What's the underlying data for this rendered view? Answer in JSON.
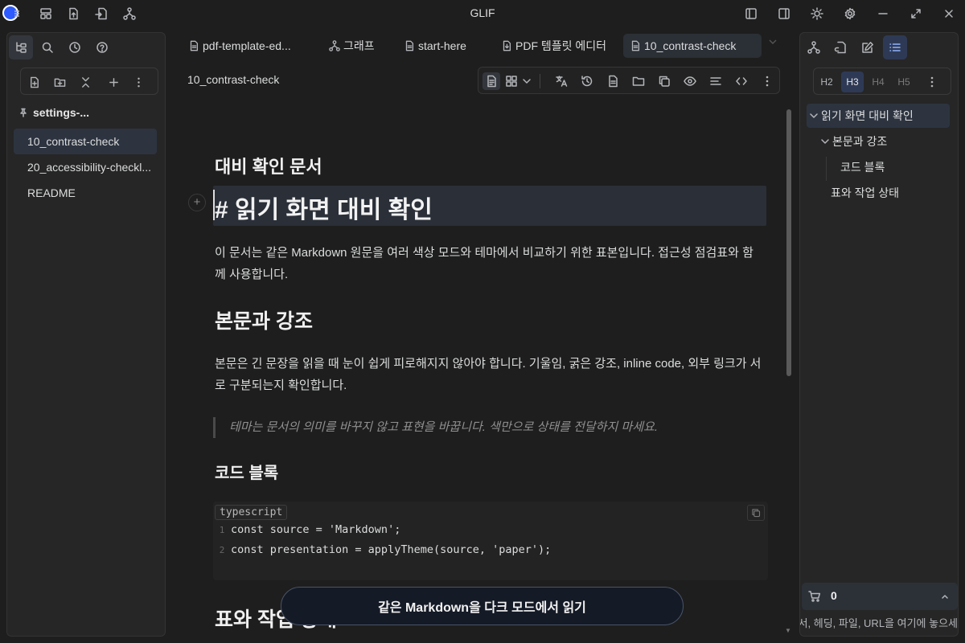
{
  "window": {
    "title": "GLIF"
  },
  "left_sidebar": {
    "vault_name": "settings-...",
    "files": [
      {
        "name": "10_contrast-check",
        "active": true
      },
      {
        "name": "20_accessibility-checkl..."
      },
      {
        "name": "README"
      }
    ]
  },
  "tabs": [
    {
      "label": "pdf-template-ed...",
      "icon": "file-icon"
    },
    {
      "label": "그래프",
      "icon": "graph-icon"
    },
    {
      "label": "start-here",
      "icon": "file-icon"
    },
    {
      "label": "PDF 템플릿 에디터",
      "icon": "pdf-icon"
    },
    {
      "label": "10_contrast-check",
      "icon": "file-icon",
      "active": true
    }
  ],
  "editor": {
    "doc_title": "10_contrast-check",
    "doc_heading": "대비 확인 문서",
    "h1": "# 읽기 화면 대비 확인",
    "para1_line1": "이 문서는 같은 Markdown 원문을 여러 색상 모드와 테마에서 비교하기 위한 표본입니다. 접근성 점검표와 함",
    "para1_line2": "께 사용합니다.",
    "h2_body": "본문과 강조",
    "para2_line1": "본문은 긴 문장을 읽을 때 눈이 쉽게 피로해지지 않아야 합니다. 기울임, 굵은 강조, inline code, 외부 링크가 서",
    "para2_line2": "로 구분되는지 확인합니다.",
    "quote": "테마는 문서의 의미를 바꾸지 않고 표현을 바꿉니다. 색만으로 상태를 전달하지 마세요.",
    "h3_code": "코드 블록",
    "code_lang": "typescript",
    "code_lines": [
      {
        "n": "1",
        "text": "const source = 'Markdown';"
      },
      {
        "n": "2",
        "text": "const presentation = applyTheme(source, 'paper');"
      }
    ],
    "h2_table": "표와 작업 상태",
    "read_dark_button": "같은 Markdown을 다크 모드에서 읽기"
  },
  "right_panel": {
    "heading_levels": [
      {
        "label": "H2"
      },
      {
        "label": "H3",
        "active": true
      },
      {
        "label": "H4",
        "dim": true
      },
      {
        "label": "H5",
        "dim": true
      }
    ],
    "outline": [
      {
        "label": "읽기 화면 대비 확인",
        "active": true
      },
      {
        "label": "본문과 강조"
      },
      {
        "label": "코드 블록"
      },
      {
        "label": "표와 작업 상태"
      }
    ],
    "cart_count": "0",
    "drop_hint": "서, 헤딩, 파일, URL을 여기에 놓으세"
  },
  "colors": {
    "accent": "#2e3a55",
    "background": "#1e1e1e",
    "panel": "#262626"
  }
}
